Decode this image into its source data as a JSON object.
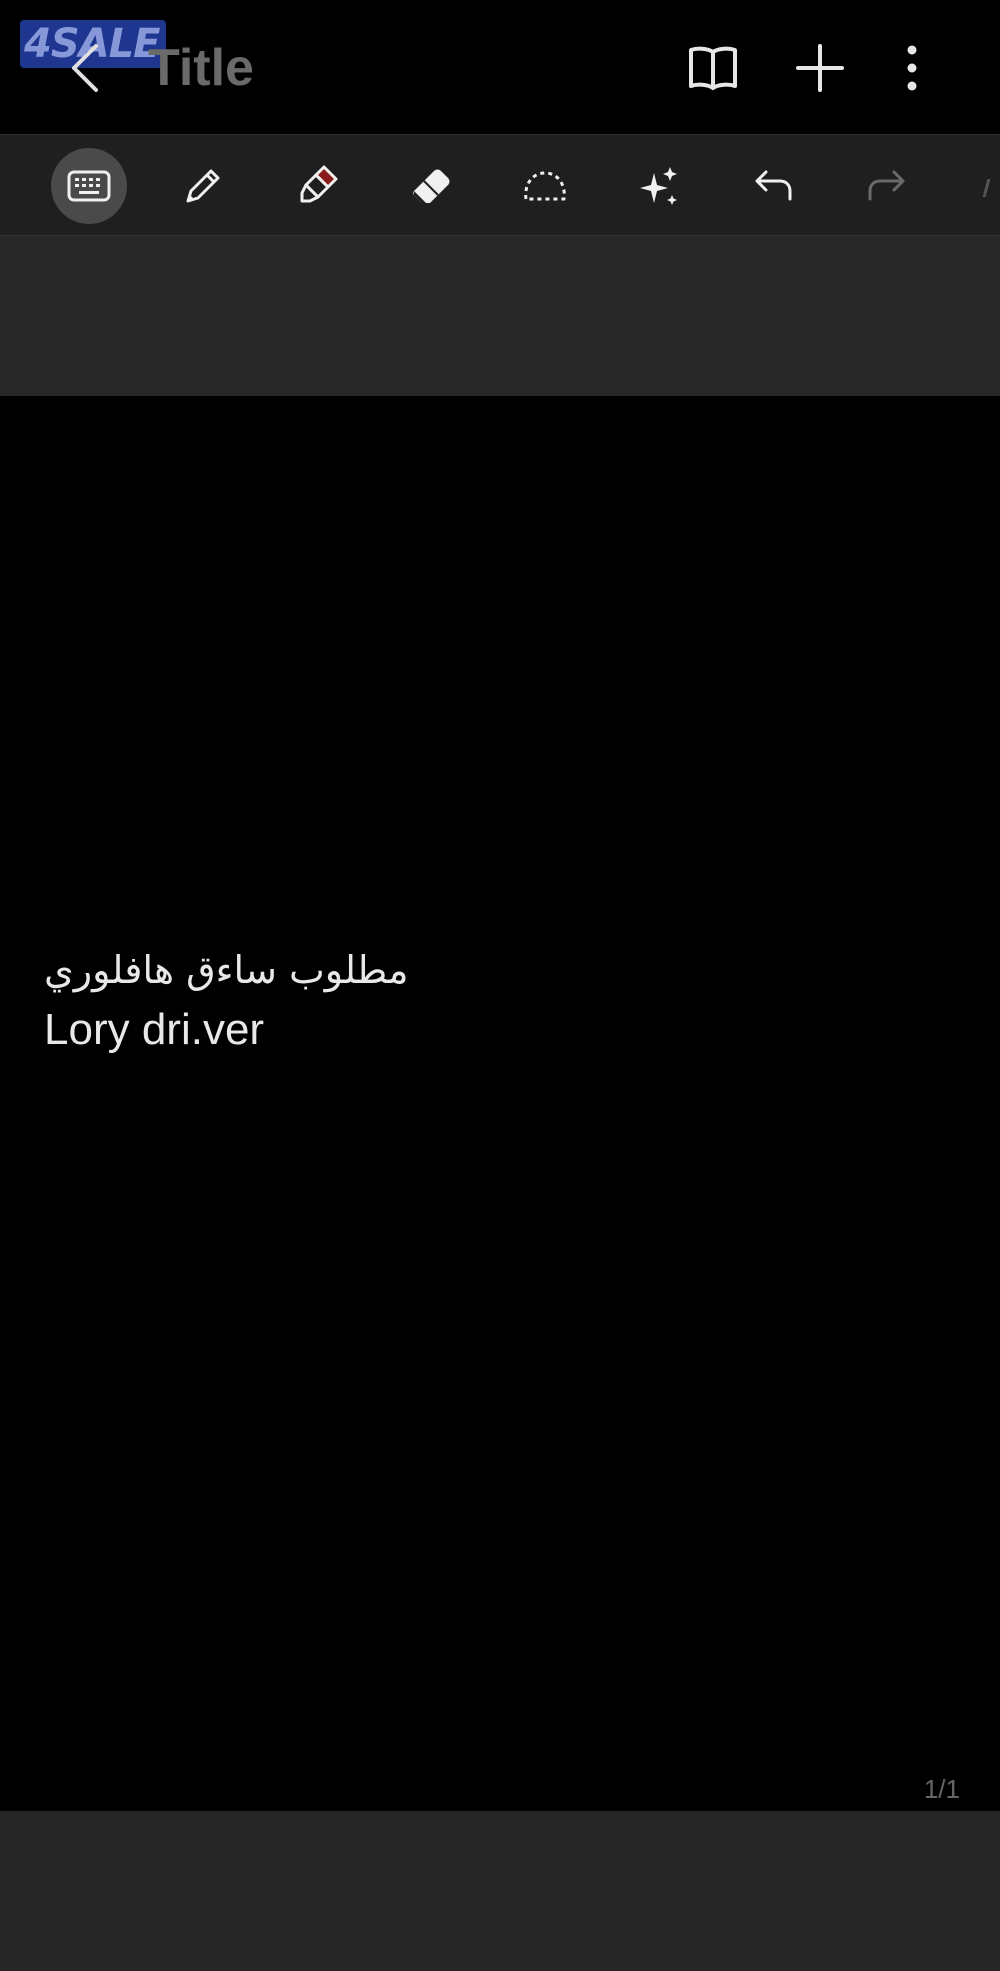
{
  "watermark": {
    "text": "4SALE"
  },
  "app_bar": {
    "title": "Title",
    "icons": {
      "back": "chevron-left-icon",
      "reading_mode": "book-open-icon",
      "add": "plus-icon",
      "more": "more-vertical-icon"
    }
  },
  "toolbar": {
    "tools": [
      {
        "name": "keyboard",
        "icon": "keyboard-icon",
        "active": true
      },
      {
        "name": "pen",
        "icon": "pen-icon",
        "active": false
      },
      {
        "name": "highlighter",
        "icon": "highlighter-icon",
        "active": false,
        "color": "#8b1a1a"
      },
      {
        "name": "eraser",
        "icon": "eraser-icon",
        "active": false
      },
      {
        "name": "lasso",
        "icon": "lasso-select-icon",
        "active": false
      },
      {
        "name": "ai",
        "icon": "sparkle-icon",
        "active": false
      },
      {
        "name": "undo",
        "icon": "undo-icon",
        "active": false
      },
      {
        "name": "redo",
        "icon": "redo-icon",
        "active": false,
        "disabled": true
      }
    ]
  },
  "note": {
    "lines": [
      "مطلوب ساءق هافلوري",
      "Lory dri.ver"
    ]
  },
  "page_indicator": "1/1",
  "colors": {
    "background": "#000000",
    "toolbar": "#1f1f1f",
    "band": "#272727",
    "active_tool": "#4a4a4a",
    "highlighter": "#8b1a1a"
  }
}
